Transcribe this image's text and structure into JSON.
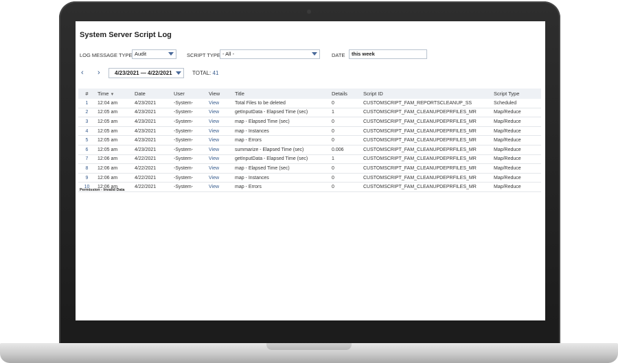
{
  "page": {
    "title": "System Server Script Log"
  },
  "filters": {
    "log_message_type_label": "LOG MESSAGE TYPE",
    "log_message_type_value": "Audit",
    "script_type_label": "SCRIPT TYPE",
    "script_type_value": "- All -",
    "date_label": "DATE",
    "date_value": "this week"
  },
  "nav": {
    "prev_glyph": "‹",
    "next_glyph": "›",
    "range": "4/23/2021 — 4/22/2021",
    "total_label": "TOTAL:",
    "total_value": "41"
  },
  "table": {
    "headers": {
      "num": "#",
      "time": "Time",
      "date": "Date",
      "user": "User",
      "view": "View",
      "title": "Title",
      "details": "Details",
      "script_id": "Script ID",
      "script_type": "Script Type"
    },
    "rows": [
      {
        "num": "1",
        "time": "12:04 am",
        "date": "4/23/2021",
        "user": "-System-",
        "view": "View",
        "title": "Total Files to be deleted",
        "details": "0",
        "script_id": "CUSTOMSCRIPT_FAM_REPORTSCLEANUP_SS",
        "script_type": "Scheduled"
      },
      {
        "num": "2",
        "time": "12:05 am",
        "date": "4/23/2021",
        "user": "-System-",
        "view": "View",
        "title": "getInputData - Elapsed Time (sec)",
        "details": "1",
        "script_id": "CUSTOMSCRIPT_FAM_CLEANUPDEPRFILES_MR",
        "script_type": "Map/Reduce"
      },
      {
        "num": "3",
        "time": "12:05 am",
        "date": "4/23/2021",
        "user": "-System-",
        "view": "View",
        "title": "map - Elapsed Time (sec)",
        "details": "0",
        "script_id": "CUSTOMSCRIPT_FAM_CLEANUPDEPRFILES_MR",
        "script_type": "Map/Reduce"
      },
      {
        "num": "4",
        "time": "12:05 am",
        "date": "4/23/2021",
        "user": "-System-",
        "view": "View",
        "title": "map - Instances",
        "details": "0",
        "script_id": "CUSTOMSCRIPT_FAM_CLEANUPDEPRFILES_MR",
        "script_type": "Map/Reduce"
      },
      {
        "num": "5",
        "time": "12:05 am",
        "date": "4/23/2021",
        "user": "-System-",
        "view": "View",
        "title": "map - Errors",
        "details": "0",
        "script_id": "CUSTOMSCRIPT_FAM_CLEANUPDEPRFILES_MR",
        "script_type": "Map/Reduce"
      },
      {
        "num": "6",
        "time": "12:05 am",
        "date": "4/23/2021",
        "user": "-System-",
        "view": "View",
        "title": "summarize - Elapsed Time (sec)",
        "details": "0.006",
        "script_id": "CUSTOMSCRIPT_FAM_CLEANUPDEPRFILES_MR",
        "script_type": "Map/Reduce"
      },
      {
        "num": "7",
        "time": "12:06 am",
        "date": "4/22/2021",
        "user": "-System-",
        "view": "View",
        "title": "getInputData - Elapsed Time (sec)",
        "details": "1",
        "script_id": "CUSTOMSCRIPT_FAM_CLEANUPDEPRFILES_MR",
        "script_type": "Map/Reduce"
      },
      {
        "num": "8",
        "time": "12:06 am",
        "date": "4/22/2021",
        "user": "-System-",
        "view": "View",
        "title": "map - Elapsed Time (sec)",
        "details": "0",
        "script_id": "CUSTOMSCRIPT_FAM_CLEANUPDEPRFILES_MR",
        "script_type": "Map/Reduce"
      },
      {
        "num": "9",
        "time": "12:06 am",
        "date": "4/22/2021",
        "user": "-System-",
        "view": "View",
        "title": "map - Instances",
        "details": "0",
        "script_id": "CUSTOMSCRIPT_FAM_CLEANUPDEPRFILES_MR",
        "script_type": "Map/Reduce"
      },
      {
        "num": "10",
        "time": "12:06 am",
        "date": "4/22/2021",
        "user": "-System-",
        "view": "View",
        "title": "map - Errors",
        "details": "0",
        "script_id": "CUSTOMSCRIPT_FAM_CLEANUPDEPRFILES_MR",
        "script_type": "Map/Reduce"
      }
    ]
  },
  "footnote": "Permission - Invalid Data",
  "icons": {
    "sort": "sort-down-icon",
    "caret": "chevron-down-icon"
  },
  "colors": {
    "link": "#355a8c",
    "header_bg": "#eef1f5"
  }
}
